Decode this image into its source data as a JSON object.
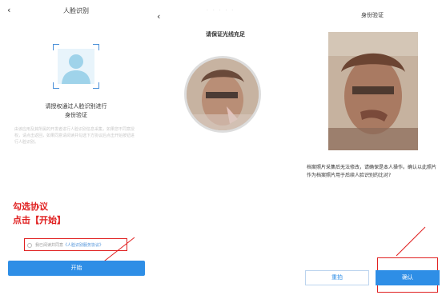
{
  "screen1": {
    "back_glyph": "‹",
    "title": "人脸识别",
    "prompt_line1": "请授权通过人脸识别进行",
    "prompt_line2": "身份验证",
    "notice_text": "由该应用及其所属的开发者进行人脸识别信息采集，如果您不同意授权，请点击返回，如果同意请阅读并勾选下方协议后点击开始按钮进行人脸识别。",
    "annotation_line1": "勾选协议",
    "annotation_line2": "点击【开始】",
    "agreement_prefix": "我已阅读并同意",
    "agreement_link": "《人脸识别服务协议》",
    "start_button": "开始",
    "accent_color": "#2e8ee6",
    "annotation_color": "#e02020",
    "face_icon": "person-silhouette-icon"
  },
  "screen2": {
    "back_glyph": "‹",
    "dots": "· · · · ·",
    "title": "请保证光线充足"
  },
  "screen3": {
    "title": "身份验证",
    "description": "档案照片采集后无法修改，请确保是本人操作。确认以此照片作为档案照片用于后续人脸识别的比对?",
    "retake_button": "重拍",
    "confirm_button": "确认"
  }
}
